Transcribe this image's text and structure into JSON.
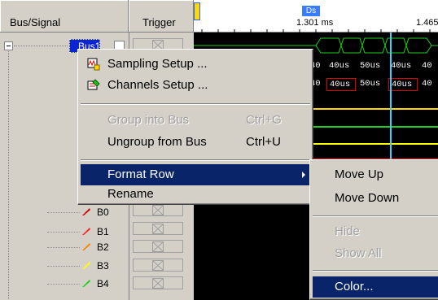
{
  "headers": {
    "bus_signal": "Bus/Signal",
    "trigger": "Trigger"
  },
  "bus": {
    "name": "Bus1"
  },
  "signals": [
    {
      "name": "B0",
      "color": "#d00000"
    },
    {
      "name": "B1",
      "color": "#ff2020"
    },
    {
      "name": "B2",
      "color": "#ff8000"
    },
    {
      "name": "B3",
      "color": "#ffff00"
    },
    {
      "name": "B4",
      "color": "#20d020"
    }
  ],
  "timeline": {
    "cursor_tag": "Ds",
    "cursor_time": "1.301 ms",
    "right_time": "1.465"
  },
  "waveform_values": {
    "row1": [
      "40",
      "40us",
      "50us",
      "40us",
      "40"
    ],
    "row2": [
      "40",
      "40us",
      "50us",
      "40us",
      "40"
    ]
  },
  "waveform_colors": [
    "#ffd800",
    "#20d020",
    "#ffff00",
    "#ff2020",
    "#ff8000"
  ],
  "context_menu": {
    "items": [
      {
        "label": "Sampling Setup ...",
        "accel": "",
        "enabled": true,
        "icon": "sampling-setup-icon"
      },
      {
        "label": "Channels Setup ...",
        "accel": "",
        "enabled": true,
        "icon": "channels-setup-icon"
      },
      {
        "label": "Group into Bus",
        "accel": "Ctrl+G",
        "enabled": false
      },
      {
        "label": "Ungroup from Bus",
        "accel": "Ctrl+U",
        "enabled": true
      },
      {
        "label": "Format Row",
        "accel": "",
        "enabled": true,
        "highlighted": true,
        "submenu": true
      },
      {
        "label": "Rename",
        "accel": "",
        "enabled": true
      }
    ]
  },
  "submenu": {
    "items": [
      {
        "label": "Move Up",
        "enabled": true
      },
      {
        "label": "Move Down",
        "enabled": true
      },
      {
        "label": "Hide",
        "enabled": false
      },
      {
        "label": "Show All",
        "enabled": false
      },
      {
        "label": "Color...",
        "enabled": true,
        "highlighted": true
      }
    ]
  }
}
